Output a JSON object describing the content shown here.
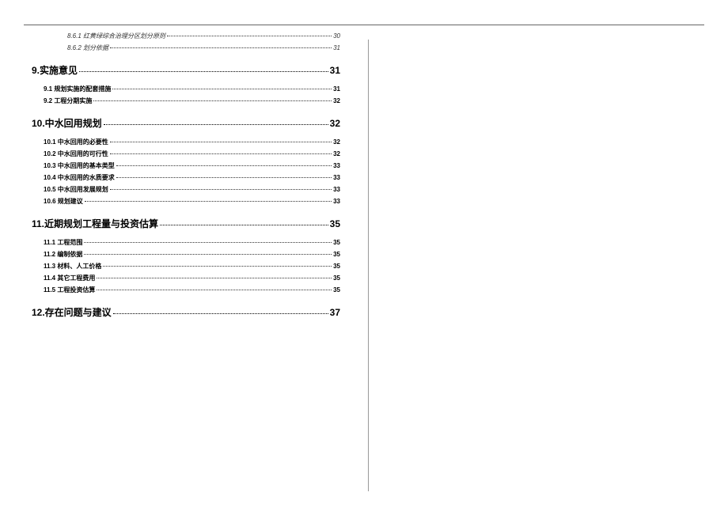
{
  "toc": {
    "presubs": [
      {
        "label": "8.6.1 红黄绿综合治理分区划分原则",
        "page": "30"
      },
      {
        "label": "8.6.2 划分依据",
        "page": "31"
      }
    ],
    "chapters": [
      {
        "label": "9.实施意见",
        "page": "31",
        "subs": [
          {
            "label": "9.1 规划实施的配套措施",
            "page": "31"
          },
          {
            "label": "9.2 工程分期实施",
            "page": "32"
          }
        ]
      },
      {
        "label": "10.中水回用规划",
        "page": "32",
        "subs": [
          {
            "label": "10.1 中水回用的必要性",
            "page": "32"
          },
          {
            "label": "10.2 中水回用的可行性",
            "page": "32"
          },
          {
            "label": "10.3 中水回用的基本类型",
            "page": "33"
          },
          {
            "label": "10.4 中水回用的水质要求",
            "page": "33"
          },
          {
            "label": "10.5 中水回用发展规划",
            "page": "33"
          },
          {
            "label": "10.6 规划建议",
            "page": "33"
          }
        ]
      },
      {
        "label": "11.近期规划工程量与投资估算",
        "page": "35",
        "subs": [
          {
            "label": "11.1 工程范围",
            "page": "35"
          },
          {
            "label": "11.2 编制依据",
            "page": "35"
          },
          {
            "label": "11.3 材料、人工价格",
            "page": "35"
          },
          {
            "label": "11.4 其它工程费用",
            "page": "35"
          },
          {
            "label": "11.5 工程投资估算",
            "page": "35"
          }
        ]
      },
      {
        "label": "12.存在问题与建议",
        "page": "37",
        "subs": []
      }
    ]
  }
}
